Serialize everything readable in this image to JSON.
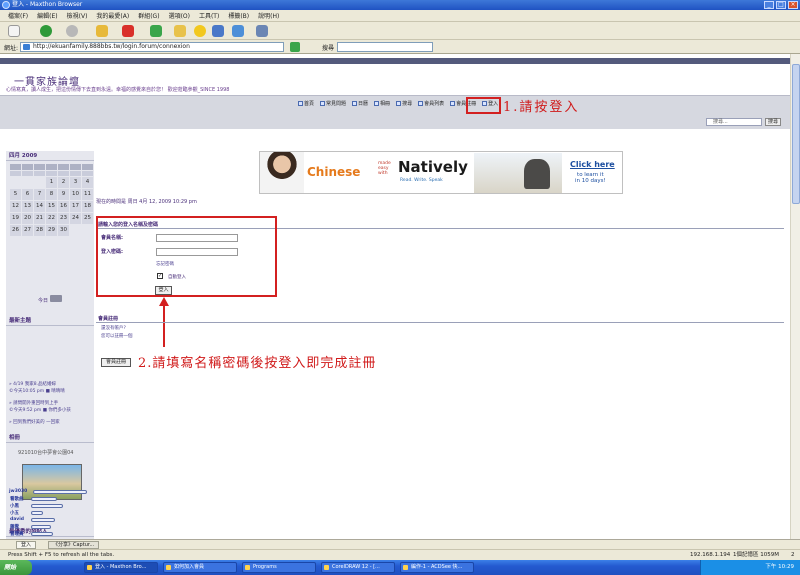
{
  "window": {
    "title": "登入 - Maxthon Browser"
  },
  "menu": [
    "檔案(F)",
    "編輯(E)",
    "檢視(V)",
    "我的最愛(A)",
    "群組(G)",
    "選項(O)",
    "工具(T)",
    "標籤(B)",
    "說明(H)"
  ],
  "address": {
    "label": "網址:",
    "url": "http://ekuanfamily.888bbs.tw/login.forum/connexion",
    "search_label": "搜尋"
  },
  "site": {
    "title": "一貫家族論壇",
    "subtitle": "心情寫真，讀人成生，把這份情傳下去直到永遠。幸福的感覺來自於您！ 歡迎蒞臨參觀_SINCE 1998"
  },
  "nav": {
    "items": [
      "首頁",
      "常見問題",
      "日曆",
      "相冊",
      "搜尋",
      "會員列表",
      "會員註冊",
      "登入"
    ]
  },
  "annotations": {
    "step1": "1.請按登入",
    "step2": "2.請填寫名稱密碼後按登入即完成註冊"
  },
  "search": {
    "placeholder": "搜尋...",
    "button": "搜尋"
  },
  "calendar": {
    "month": "四月 2009",
    "rows": [
      [
        "",
        "",
        "",
        "1",
        "2",
        "3",
        "4"
      ],
      [
        "5",
        "6",
        "7",
        "8",
        "9",
        "10",
        "11"
      ],
      [
        "12",
        "13",
        "14",
        "15",
        "16",
        "17",
        "18"
      ],
      [
        "19",
        "20",
        "21",
        "22",
        "23",
        "24",
        "25"
      ],
      [
        "26",
        "27",
        "28",
        "29",
        "30",
        "",
        ""
      ]
    ],
    "today_label": "今日"
  },
  "sidebar": {
    "latest_title": "最新主題",
    "latest_items": [
      "» 4/19 我家8.品結婚嫁",
      "©今天10:05 pm ■ 晴晴晴",
      "» 請問開外重回時到上手",
      "©今天9:52 pm ■ 你們多小孩",
      "» 回到我們好美的 一回家"
    ],
    "links_title": "相冊",
    "links_caption": "921010台中夢會公園04",
    "online_title": "最優秀的發帖人",
    "online_names": [
      "jw3030",
      "看歌曲",
      "小黑",
      "小五",
      "david",
      "藤雲",
      "管理員"
    ]
  },
  "banner": {
    "part1": "Chinese",
    "made": "made\neasy\nwith",
    "part2": "Natively",
    "tagline": "Read. Write. Speak",
    "cta": "Click here",
    "cta_sub": "to learn it\nin 10 days!"
  },
  "main": {
    "visit_time": "現在的時間是 周日 4月 12, 2009 10:29 pm",
    "login_title": "請輸入您的登入名稱及密碼",
    "username_label": "會員名稱:",
    "password_label": "登入密碼:",
    "forgot": "忘記密碼",
    "auto_login": "自動登入",
    "login_button": "登入",
    "register_title": "會員註冊",
    "register_q": "還沒有帳戶?",
    "register_hint": "您可以註冊一個",
    "register_button": "會員註冊"
  },
  "tabs": [
    "登入",
    "《分享》Captur..."
  ],
  "status": {
    "left": "Press Shift + F5 to refresh all the tabs.",
    "ip": "192.168.1.194",
    "mem": "1個記憶區 1059M",
    "page": "2"
  },
  "taskbar": {
    "start": "開始",
    "tasks": [
      "登入 - Maxthon Bro...",
      "如何加入會員",
      "Programs",
      "CorelDRAW 12 - [...",
      "編作-1 - ACDSee 快..."
    ],
    "clock": "下午 10:29"
  }
}
